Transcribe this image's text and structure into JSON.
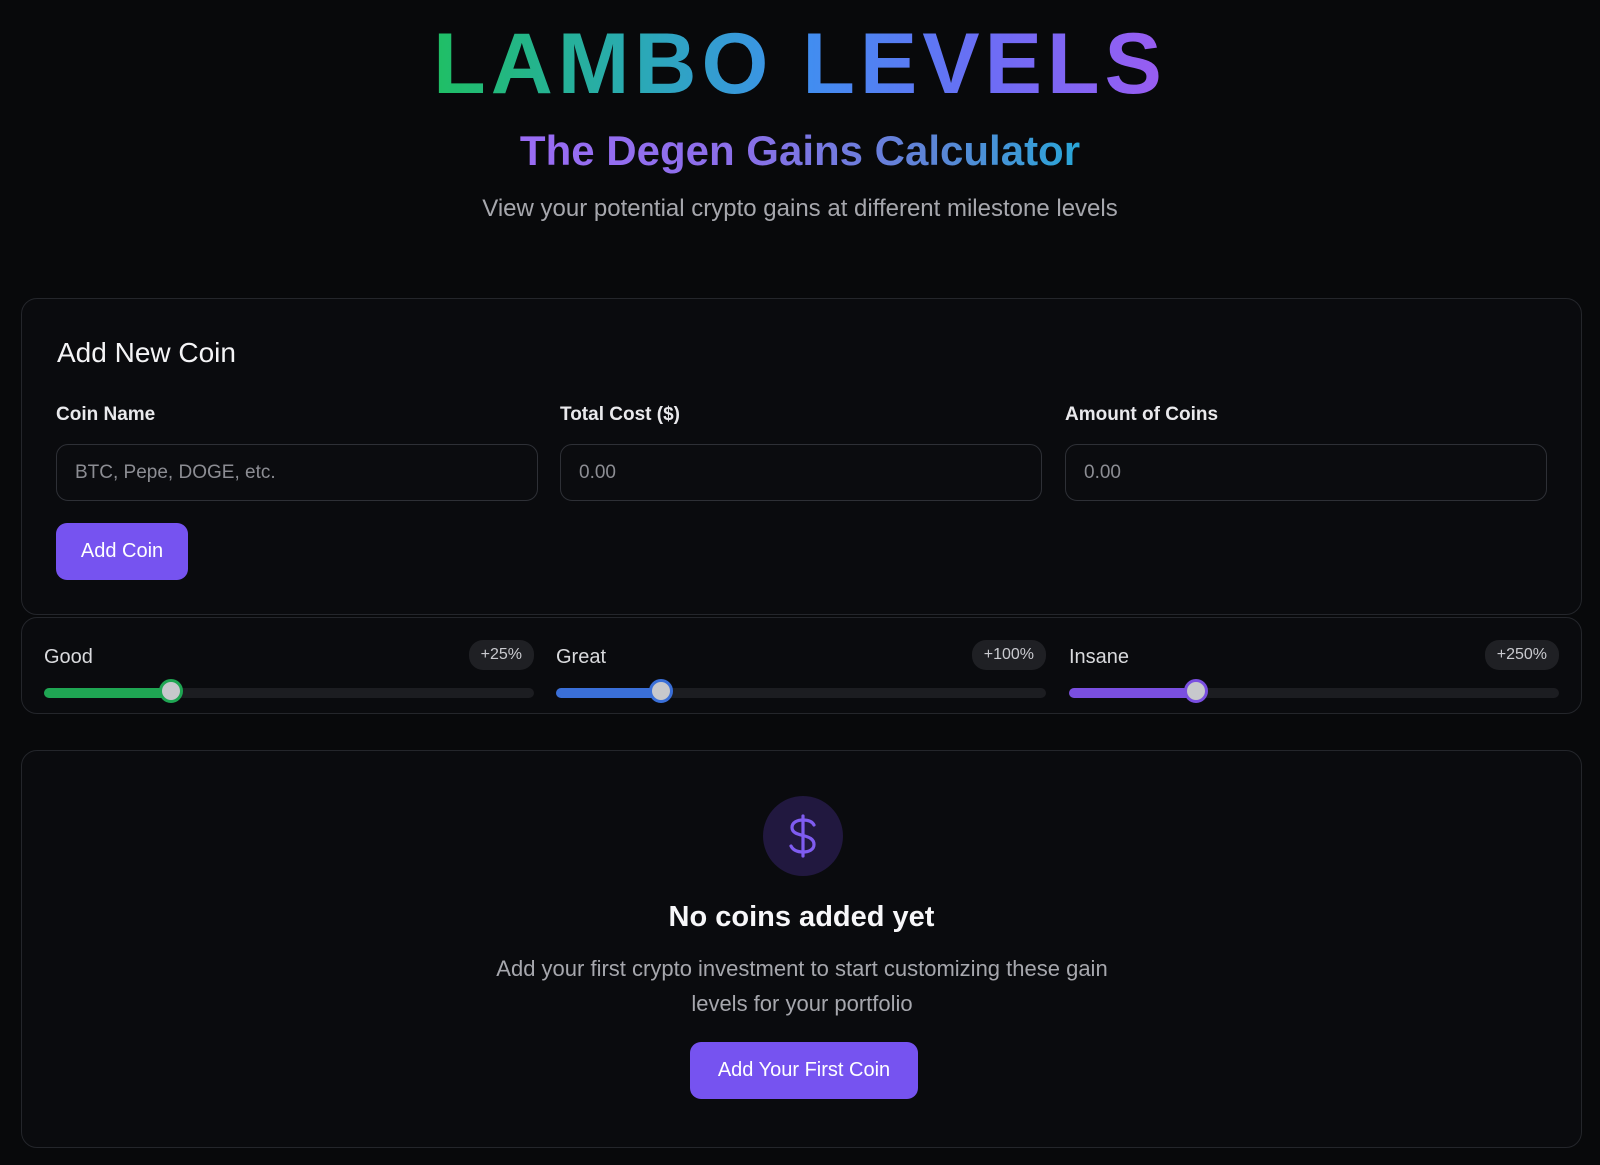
{
  "header": {
    "logo": "LAMBO LEVELS",
    "subtitle": "The Degen Gains Calculator",
    "tagline": "View your potential crypto gains at different milestone levels"
  },
  "add_coin": {
    "title": "Add New Coin",
    "fields": [
      {
        "label": "Coin Name",
        "placeholder": "BTC, Pepe, DOGE, etc.",
        "value": ""
      },
      {
        "label": "Total Cost ($)",
        "placeholder": "0.00",
        "value": ""
      },
      {
        "label": "Amount of Coins",
        "placeholder": "0.00",
        "value": ""
      }
    ],
    "button": "Add Coin"
  },
  "levels": [
    {
      "name": "Good",
      "badge": "+25%",
      "fraction": 0.26,
      "color": "#1fa653",
      "thumb_border": "#1fa653"
    },
    {
      "name": "Great",
      "badge": "+100%",
      "fraction": 0.215,
      "color": "#3a6fd8",
      "thumb_border": "#3a6fd8"
    },
    {
      "name": "Insane",
      "badge": "+250%",
      "fraction": 0.26,
      "color": "#7a4fe0",
      "thumb_border": "#7a4fe0"
    }
  ],
  "empty_state": {
    "icon": "dollar-icon",
    "icon_glyph": "$",
    "title": "No coins added yet",
    "text": "Add your first crypto investment to start customizing these gain levels for your portfolio",
    "button": "Add Your First Coin"
  },
  "colors": {
    "accent": "#7653f0",
    "background": "#08090b"
  }
}
